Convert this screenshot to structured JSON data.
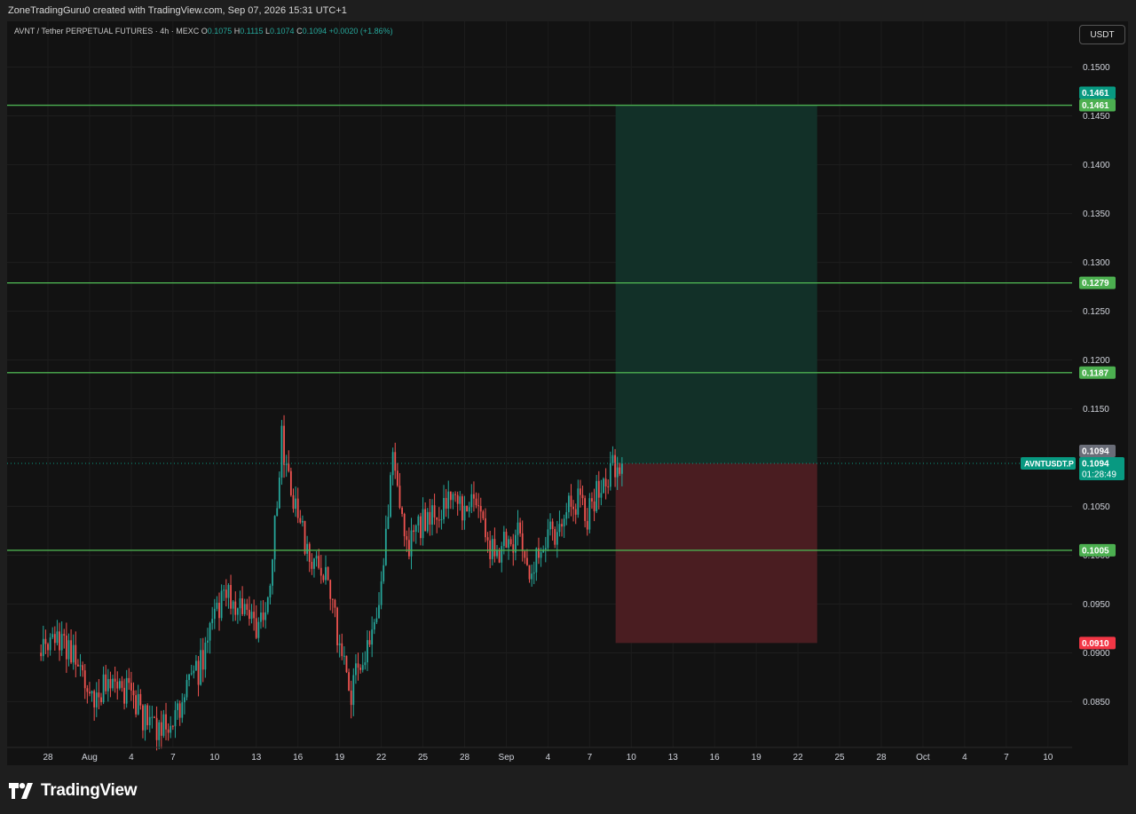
{
  "header": {
    "attribution": "ZoneTradingGuru0 created with TradingView.com, Sep 07, 2026 15:31 UTC+1"
  },
  "legend": {
    "symbol": "AVNT / Tether PERPETUAL FUTURES · 4h · MEXC",
    "open_key": "O",
    "open": "0.1075",
    "high_key": "H",
    "high": "0.1115",
    "low_key": "L",
    "low": "0.1074",
    "close_key": "C",
    "close": "0.1094",
    "change": "+0.0020 (+1.86%)"
  },
  "toolbar": {
    "currency": "USDT"
  },
  "footer": {
    "brand": "TradingView"
  },
  "colors": {
    "background": "#121212",
    "up": "#26a69a",
    "down": "#ef5350",
    "level_line": "#4caf50",
    "target_zone": "#123028",
    "stop_zone": "#4a1d21",
    "stop_label": "#f23645",
    "last_price_label": "#089981"
  },
  "chart_data": {
    "type": "candlestick",
    "timeframe": "4h",
    "y_axis": {
      "range": [
        0.0803,
        0.1547
      ],
      "ticks": [
        "0.1500",
        "0.1450",
        "0.1400",
        "0.1350",
        "0.1300",
        "0.1250",
        "0.1200",
        "0.1150",
        "0.1100",
        "0.1050",
        "0.1000",
        "0.0950",
        "0.0900",
        "0.0850"
      ]
    },
    "x_axis": {
      "ticks": [
        "28",
        "Aug",
        "4",
        "7",
        "10",
        "13",
        "16",
        "19",
        "22",
        "25",
        "28",
        "Sep",
        "4",
        "7",
        "10",
        "13",
        "16",
        "19",
        "22",
        "25",
        "28",
        "Oct",
        "4",
        "7",
        "10"
      ]
    },
    "anchors": [
      [
        "Jul 28",
        0.09
      ],
      [
        "Jul 29",
        0.0915
      ],
      [
        "Jul 30",
        0.0895
      ],
      [
        "Jul 31",
        0.0855
      ],
      [
        "Aug 1",
        0.0865
      ],
      [
        "Aug 2",
        0.0868
      ],
      [
        "Aug 3",
        0.0858
      ],
      [
        "Aug 4",
        0.0835
      ],
      [
        "Aug 5",
        0.0825
      ],
      [
        "Aug 6",
        0.0832
      ],
      [
        "Aug 7",
        0.0855
      ],
      [
        "Aug 8",
        0.088
      ],
      [
        "Aug 9",
        0.0925
      ],
      [
        "Aug 10",
        0.096
      ],
      [
        "Aug 11",
        0.095
      ],
      [
        "Aug 12",
        0.0925
      ],
      [
        "Aug 13",
        0.0945
      ],
      [
        "Aug 14",
        0.112
      ],
      [
        "Aug 15",
        0.105
      ],
      [
        "Aug 16",
        0.1
      ],
      [
        "Aug 17",
        0.099
      ],
      [
        "Aug 18",
        0.092
      ],
      [
        "Aug 19",
        0.086
      ],
      [
        "Aug 20",
        0.0905
      ],
      [
        "Aug 21",
        0.095
      ],
      [
        "Aug 22",
        0.11
      ],
      [
        "Aug 23",
        0.1
      ],
      [
        "Aug 24",
        0.103
      ],
      [
        "Aug 25",
        0.104
      ],
      [
        "Aug 26",
        0.106
      ],
      [
        "Aug 27",
        0.105
      ],
      [
        "Aug 28",
        0.106
      ],
      [
        "Aug 29",
        0.1
      ],
      [
        "Aug 30",
        0.101
      ],
      [
        "Aug 31",
        0.102
      ],
      [
        "Sep 1",
        0.098
      ],
      [
        "Sep 2",
        0.102
      ],
      [
        "Sep 3",
        0.1025
      ],
      [
        "Sep 4",
        0.106
      ],
      [
        "Sep 5",
        0.104
      ],
      [
        "Sep 6",
        0.107
      ],
      [
        "Sep 7",
        0.1094
      ]
    ],
    "horizontal_levels": [
      {
        "price": 0.1461,
        "label": "0.1461"
      },
      {
        "price": 0.1279,
        "label": "0.1279"
      },
      {
        "price": 0.1187,
        "label": "0.1187"
      },
      {
        "price": 0.1005,
        "label": "0.1005"
      }
    ],
    "long_position": {
      "entry": 0.1094,
      "target": 0.1461,
      "target_label": "0.1461",
      "stop": 0.091,
      "stop_label": "0.0910",
      "start": "Sep 7",
      "end": "Sep 21"
    },
    "last_price": {
      "symbol": "AVNTUSDT.P",
      "price": 0.1094,
      "price_label": "0.1094",
      "high_label": "0.1094",
      "countdown": "01:28:49"
    }
  }
}
